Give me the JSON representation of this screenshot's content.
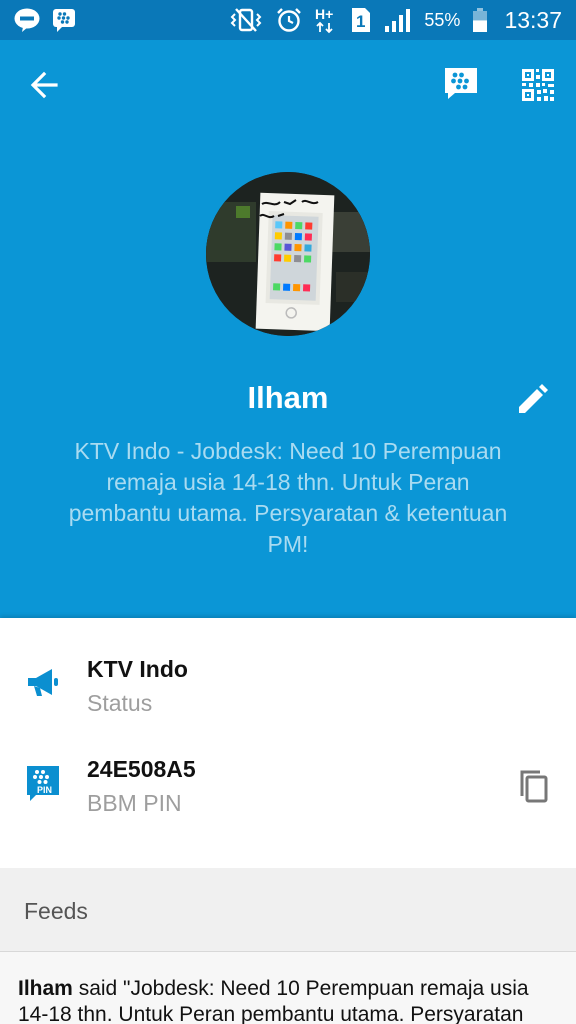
{
  "status_bar": {
    "left_icons": [
      "line-app-icon",
      "bbm-app-icon"
    ],
    "right_icons": [
      "vibrate-icon",
      "alarm-icon",
      "network-h-plus-icon",
      "sim-1-icon",
      "signal-icon"
    ],
    "network_label": "H+",
    "sim_label": "1",
    "battery_percent": "55%",
    "battery_level": 0.55,
    "time": "13:37"
  },
  "header": {
    "back_icon": "arrow-left-icon",
    "chat_icon": "bbm-chat-icon",
    "qr_icon": "qr-code-icon",
    "avatar_handwriting": "iPhone 5S 16GB",
    "name": "Ilham",
    "edit_icon": "pencil-icon",
    "status_message": "KTV Indo - Jobdesk: Need 10 Perempuan remaja usia 14-18 thn. Untuk Peran pembantu utama. Persyaratan & ketentuan PM!"
  },
  "info": {
    "status": {
      "icon": "megaphone-icon",
      "title": "KTV Indo",
      "subtitle": "Status"
    },
    "pin": {
      "icon": "bbm-pin-icon",
      "icon_label": "PIN",
      "title": "24E508A5",
      "subtitle": "BBM PIN",
      "copy_icon": "copy-icon"
    }
  },
  "feeds": {
    "label": "Feeds",
    "items": [
      {
        "author": "Ilham",
        "text": " said \"Jobdesk: Need 10 Perempuan remaja usia 14-18 thn. Untuk Peran pembantu utama. Persyaratan"
      }
    ]
  },
  "colors": {
    "status_bar": "#0a78b8",
    "header": "#0b96d6",
    "status_text": "#a9dbf1",
    "icon_accent": "#0b8fd0",
    "subtitle": "#9e9e9e",
    "feeds_bg": "#f0f0f0"
  }
}
